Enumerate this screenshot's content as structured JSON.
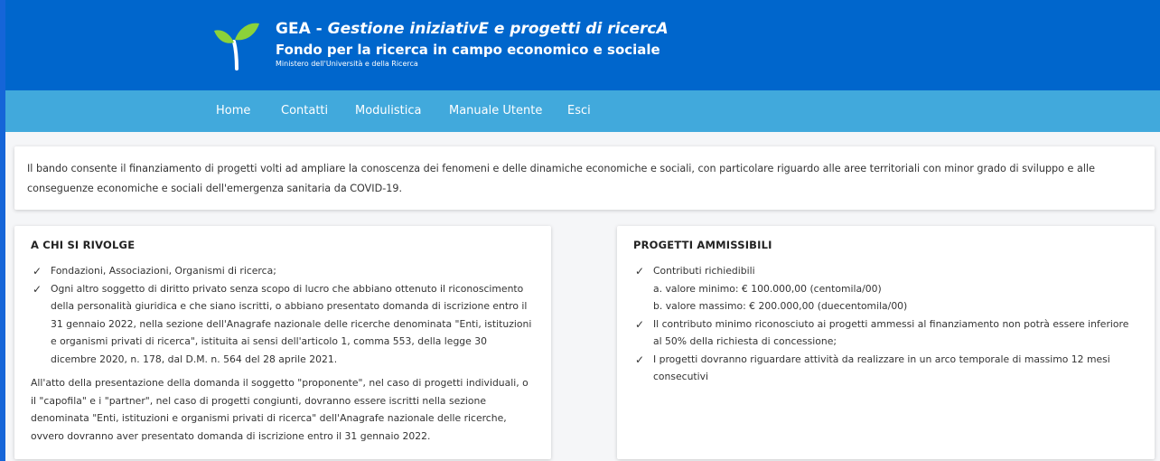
{
  "header": {
    "title_prefix": "GEA - ",
    "title_italic": "Gestione iniziativE e progetti di ricercA",
    "subtitle": "Fondo per la ricerca in campo economico e sociale",
    "ministry": "Ministero dell'Università e della Ricerca"
  },
  "nav": {
    "items": [
      {
        "label": "Home"
      },
      {
        "label": "Contatti"
      },
      {
        "label": "Modulistica"
      },
      {
        "label": "Manuale Utente"
      },
      {
        "label": "Esci"
      }
    ]
  },
  "intro": {
    "text": "Il bando consente il finanziamento di progetti volti ad ampliare la conoscenza dei fenomeni e delle dinamiche economiche e sociali, con particolare riguardo alle aree territoriali con minor grado di sviluppo e alle conseguenze economiche e sociali dell'emergenza sanitaria da COVID-19."
  },
  "a_chi_si_rivolge": {
    "title": "A CHI SI RIVOLGE",
    "items": [
      {
        "text": "Fondazioni, Associazioni, Organismi di ricerca;"
      },
      {
        "text": "Ogni altro soggetto di diritto privato senza scopo di lucro che abbiano ottenuto il riconoscimento della personalità giuridica e che siano iscritti, o abbiano presentato domanda di iscrizione entro il 31 gennaio 2022, nella sezione dell'Anagrafe nazionale delle ricerche denominata \"Enti, istituzioni e organismi privati di ricerca\", istituita ai sensi dell'articolo 1, comma 553, della legge 30 dicembre 2020, n. 178, dal D.M. n. 564 del 28 aprile 2021."
      }
    ],
    "paragraph": "All'atto della presentazione della domanda il soggetto \"proponente\", nel caso di progetti individuali, o il \"capofila\" e i \"partner\", nel caso di progetti congiunti, dovranno essere iscritti nella sezione denominata \"Enti, istituzioni e organismi privati di ricerca\" dell'Anagrafe nazionale delle ricerche, ovvero dovranno aver presentato domanda di iscrizione entro il 31 gennaio 2022."
  },
  "progetti_ammissibili": {
    "title": "PROGETTI AMMISSIBILI",
    "item1": "Contributi richiedibili",
    "item1_a": "a. valore minimo: € 100.000,00 (centomila/00)",
    "item1_b": "b. valore massimo: € 200.000,00 (duecentomila/00)",
    "item2": "Il contributo minimo riconosciuto ai progetti ammessi al finanziamento non potrà essere inferiore al 50% della richiesta di concessione;",
    "item3": "I progetti dovranno riguardare attività da realizzare in un arco temporale di massimo 12 mesi consecutivi"
  },
  "icons": {
    "logo": "sprout-logo-icon",
    "check": "check-icon"
  },
  "colors": {
    "header_bg": "#0066cc",
    "nav_bg": "#41a9dc",
    "logo_leaf": "#8bd23a"
  }
}
